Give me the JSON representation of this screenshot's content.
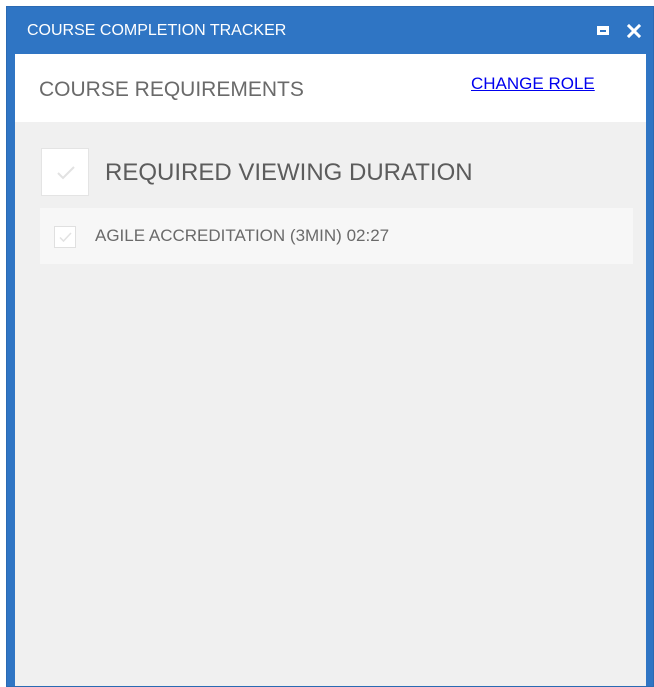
{
  "window": {
    "title": "COURSE COMPLETION TRACKER",
    "accent_color": "#2f75c4",
    "controls": {
      "maximize_icon": "maximize-icon",
      "close_icon": "close-icon"
    }
  },
  "header": {
    "title": "COURSE REQUIREMENTS",
    "change_role_label": "CHANGE ROLE"
  },
  "requirements": {
    "section_title": "REQUIRED VIEWING DURATION",
    "section_checked": false,
    "items": [
      {
        "label": "AGILE ACCREDITATION (3MIN) 02:27",
        "checked": false
      }
    ]
  }
}
